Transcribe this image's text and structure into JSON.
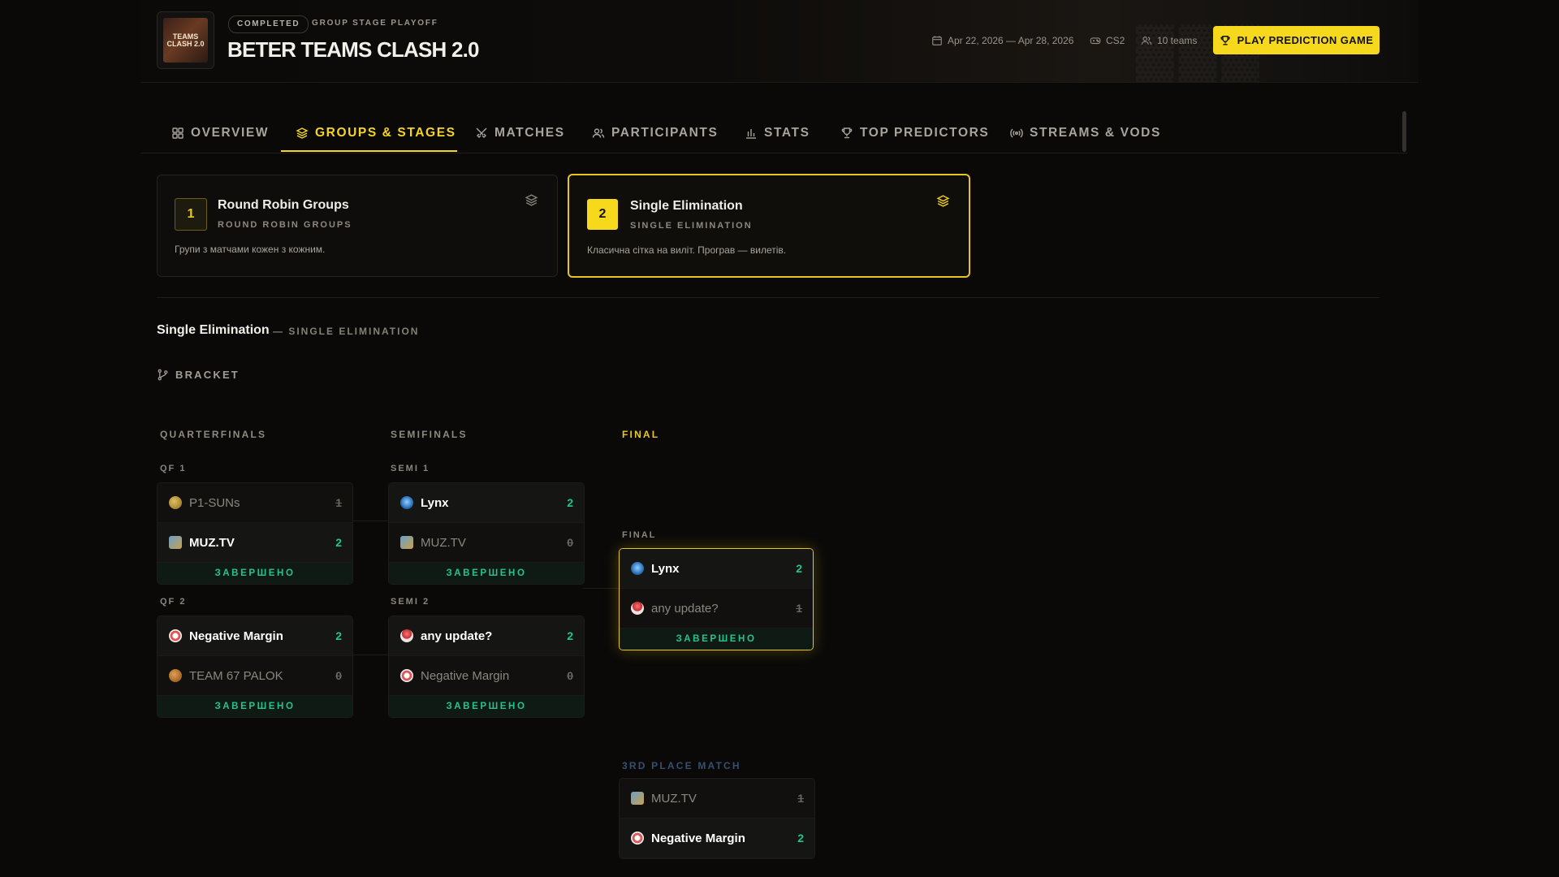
{
  "header": {
    "logo_text": "TEAMS CLASH 2.0",
    "status_badge": "COMPLETED",
    "stage_badge": "GROUP STAGE PLAYOFF",
    "title": "BETER TEAMS CLASH 2.0",
    "dates": "Apr 22, 2026 — Apr 28, 2026",
    "game": "CS2",
    "teams_count": "10 teams",
    "play_button": "PLAY PREDICTION GAME"
  },
  "tabs": [
    {
      "label": "OVERVIEW",
      "icon": "grid-icon"
    },
    {
      "label": "GROUPS & STAGES",
      "icon": "layers-icon",
      "active": true
    },
    {
      "label": "MATCHES",
      "icon": "swords-icon"
    },
    {
      "label": "PARTICIPANTS",
      "icon": "users-icon"
    },
    {
      "label": "STATS",
      "icon": "bar-chart-icon"
    },
    {
      "label": "TOP PREDICTORS",
      "icon": "trophy-icon"
    },
    {
      "label": "STREAMS & VODS",
      "icon": "broadcast-icon"
    }
  ],
  "stages": [
    {
      "number": "1",
      "title": "Round Robin Groups",
      "subtitle": "ROUND ROBIN GROUPS",
      "description": "Групи з матчами кожен з кожним.",
      "selected": false
    },
    {
      "number": "2",
      "title": "Single Elimination",
      "subtitle": "SINGLE ELIMINATION",
      "description": "Класична сітка на виліт. Програв — вилетів.",
      "selected": true
    }
  ],
  "section": {
    "title": "Single Elimination",
    "subtitle": "— SINGLE ELIMINATION",
    "bracket_label": "BRACKET"
  },
  "rounds": {
    "quarterfinals": "QUARTERFINALS",
    "semifinals": "SEMIFINALS",
    "final": "FINAL",
    "third_place": "3RD PLACE MATCH"
  },
  "matches": {
    "qf1": {
      "label": "QF 1",
      "status": "ЗАВЕРШЕНО",
      "teams": [
        {
          "name": "P1-SUNs",
          "score": "1",
          "winner": false,
          "icon": "p1-suns-logo",
          "color": "#c9a040"
        },
        {
          "name": "MUZ.TV",
          "score": "2",
          "winner": true,
          "icon": "muz-tv-logo",
          "color": "#5a8fb8"
        }
      ]
    },
    "qf2": {
      "label": "QF 2",
      "status": "ЗАВЕРШЕНО",
      "teams": [
        {
          "name": "Negative Margin",
          "score": "2",
          "winner": true,
          "icon": "negative-margin-logo",
          "color": "#e05555"
        },
        {
          "name": "TEAM 67 PALOK",
          "score": "0",
          "winner": false,
          "icon": "team-67-palok-logo",
          "color": "#c98a3a"
        }
      ]
    },
    "semi1": {
      "label": "SEMI 1",
      "status": "ЗАВЕРШЕНО",
      "teams": [
        {
          "name": "Lynx",
          "score": "2",
          "winner": true,
          "icon": "lynx-logo",
          "color": "#3a8fd6"
        },
        {
          "name": "MUZ.TV",
          "score": "0",
          "winner": false,
          "icon": "muz-tv-logo",
          "color": "#5a8fb8"
        }
      ]
    },
    "semi2": {
      "label": "SEMI 2",
      "status": "ЗАВЕРШЕНО",
      "teams": [
        {
          "name": "any update?",
          "score": "2",
          "winner": true,
          "icon": "any-update-logo",
          "color": "#d84a4a"
        },
        {
          "name": "Negative Margin",
          "score": "0",
          "winner": false,
          "icon": "negative-margin-logo",
          "color": "#e05555"
        }
      ]
    },
    "final": {
      "label": "FINAL",
      "status": "ЗАВЕРШЕНО",
      "teams": [
        {
          "name": "Lynx",
          "score": "2",
          "winner": true,
          "icon": "lynx-logo",
          "color": "#3a8fd6"
        },
        {
          "name": "any update?",
          "score": "1",
          "winner": false,
          "icon": "any-update-logo",
          "color": "#d84a4a"
        }
      ]
    },
    "third": {
      "teams": [
        {
          "name": "MUZ.TV",
          "score": "1",
          "winner": false,
          "icon": "muz-tv-logo",
          "color": "#5a8fb8"
        },
        {
          "name": "Negative Margin",
          "score": "2",
          "winner": true,
          "icon": "negative-margin-logo",
          "color": "#e05555"
        }
      ]
    }
  },
  "colors": {
    "accent": "#f6d91c",
    "win": "#22c58a",
    "background": "#0a0908"
  }
}
